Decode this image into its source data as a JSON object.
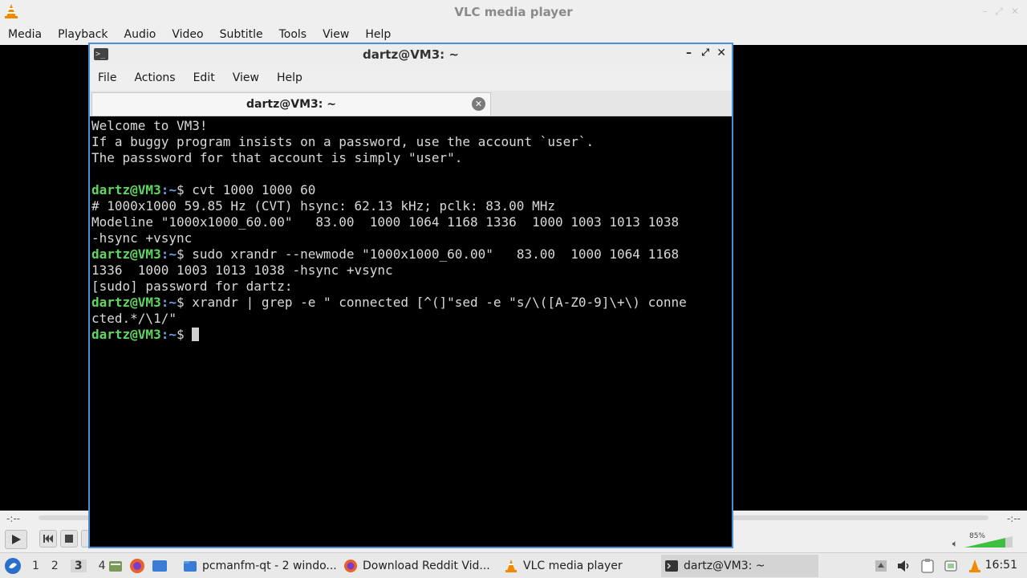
{
  "vlc": {
    "title": "VLC media player",
    "menu": [
      "Media",
      "Playback",
      "Audio",
      "Video",
      "Subtitle",
      "Tools",
      "View",
      "Help"
    ],
    "time_elapsed": "-:--",
    "time_total": "-:--",
    "volume_percent": "85%",
    "volume_level": 0.85,
    "accent_color": "#f08a00"
  },
  "terminal": {
    "title": "dartz@VM3: ~",
    "menu": [
      "File",
      "Actions",
      "Edit",
      "View",
      "Help"
    ],
    "tab_label": "dartz@VM3: ~",
    "prompt_user": "dartz@VM3",
    "prompt_path": ":~",
    "prompt_symbol": "$ ",
    "lines": [
      {
        "type": "text",
        "text": "Welcome to VM3!"
      },
      {
        "type": "text",
        "text": "If a buggy program insists on a password, use the account `user`."
      },
      {
        "type": "text",
        "text": "The passsword for that account is simply \"user\"."
      },
      {
        "type": "text",
        "text": ""
      },
      {
        "type": "prompt",
        "text": "cvt 1000 1000 60"
      },
      {
        "type": "text",
        "text": "# 1000x1000 59.85 Hz (CVT) hsync: 62.13 kHz; pclk: 83.00 MHz"
      },
      {
        "type": "text",
        "text": "Modeline \"1000x1000_60.00\"   83.00  1000 1064 1168 1336  1000 1003 1013 1038"
      },
      {
        "type": "text",
        "text": "-hsync +vsync"
      },
      {
        "type": "prompt",
        "text": "sudo xrandr --newmode \"1000x1000_60.00\"   83.00  1000 1064 1168"
      },
      {
        "type": "text",
        "text": "1336  1000 1003 1013 1038 -hsync +vsync"
      },
      {
        "type": "text",
        "text": "[sudo] password for dartz:"
      },
      {
        "type": "prompt",
        "text": "xrandr | grep -e \" connected [^(]\"sed -e \"s/\\([A-Z0-9]\\+\\) conne"
      },
      {
        "type": "text",
        "text": "cted.*/\\1/\""
      },
      {
        "type": "prompt_cursor",
        "text": ""
      }
    ]
  },
  "taskbar": {
    "workspaces": [
      "1",
      "2",
      "3",
      "4"
    ],
    "active_workspace": "3",
    "tasks": [
      {
        "label": "pcmanfm-qt - 2 windo...",
        "icon": "folder-icon"
      },
      {
        "label": "Download Reddit Vid...",
        "icon": "firefox-icon"
      },
      {
        "label": "VLC media player",
        "icon": "vlc-icon"
      },
      {
        "label": "dartz@VM3: ~",
        "icon": "terminal-icon"
      }
    ],
    "clock": "16:51"
  }
}
